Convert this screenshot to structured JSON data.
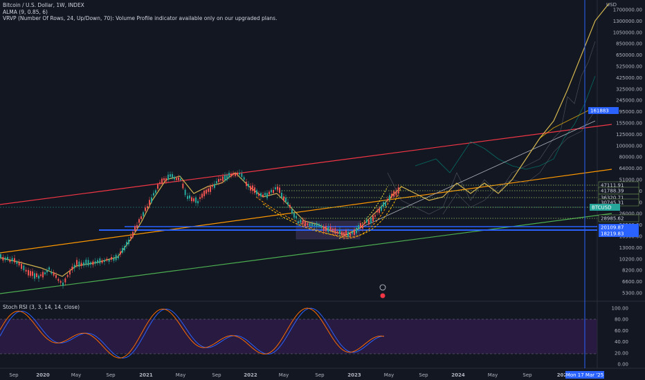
{
  "header": {
    "symbol_line": "Bitcoin / U.S. Dollar, 1W, INDEX",
    "alma_line": "ALMA (9, 0.85, 6)",
    "vrvp_line": "VRVP (Number Of Rows, 24, Up/Down, 70): Volume Profile indicator available only on our upgraded plans."
  },
  "price_axis": {
    "currency": "USD",
    "ticks": [
      "1700000.00",
      "1300000.00",
      "1050000.00",
      "850000.00",
      "650000.00",
      "525000.00",
      "425000.00",
      "325000.00",
      "245000.00",
      "195000.00",
      "155000.00",
      "125000.00",
      "100000.00",
      "80000.00",
      "64000.00",
      "51000.00",
      "41000.00",
      "33000.00",
      "26000.00",
      "20500.00",
      "16500.00",
      "13000.00",
      "10200.00",
      "8200.00",
      "6600.00",
      "5300.00"
    ],
    "labels": [
      {
        "text": "161883",
        "color": "#2962ff",
        "name": "target-price-label"
      },
      {
        "text": "47111.91",
        "color": "#131722",
        "name": "level-label-47111"
      },
      {
        "text": "41788.39",
        "color": "#131722",
        "name": "level-label-41788"
      },
      {
        "text": "36320.71",
        "color": "#131722",
        "name": "level-label-36320"
      },
      {
        "text": "30745.31",
        "color": "#131722",
        "name": "level-label-30745"
      },
      {
        "text": "BTCUSD",
        "color": "#26a69a",
        "name": "symbol-price-tag"
      },
      {
        "text": "28985.62",
        "color": "#131722",
        "name": "level-label-28985"
      },
      {
        "text": "20109.87",
        "color": "#2962ff",
        "name": "level-label-20109"
      },
      {
        "text": "18219.83",
        "color": "#2962ff",
        "name": "level-label-18219"
      }
    ]
  },
  "time_axis": {
    "ticks": [
      "Sep",
      "2020",
      "May",
      "Sep",
      "2021",
      "May",
      "Sep",
      "2022",
      "May",
      "Sep",
      "2023",
      "May",
      "Sep",
      "2024",
      "May",
      "Sep",
      "202"
    ],
    "crosshair_label": "Mon 17 Mar '25"
  },
  "stoch_rsi": {
    "title": "Stoch RSI (3, 3, 14, 14, close)",
    "ticks": [
      "100.00",
      "80.00",
      "60.00",
      "40.00",
      "20.00",
      "0.00"
    ]
  },
  "colors": {
    "background": "#131722",
    "upper_channel": "#f23645",
    "orange_trend": "#ff9800",
    "green_support": "#4caf50",
    "blue_levels": "#2962ff",
    "alma": "#d4b64f",
    "rsi_band": "#3b1e5a"
  }
}
